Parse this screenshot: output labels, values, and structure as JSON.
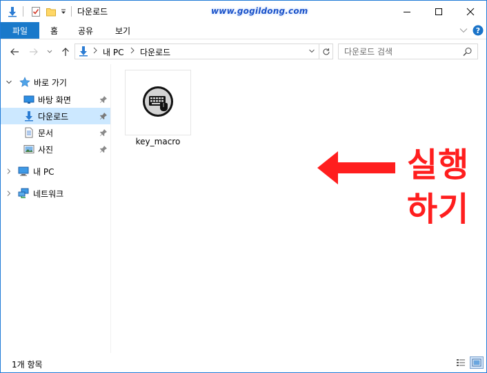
{
  "window": {
    "title": "다운로드",
    "watermark": "www.gogildong.com"
  },
  "ribbon": {
    "tabs": [
      "파일",
      "홈",
      "공유",
      "보기"
    ],
    "active_tab": "파일"
  },
  "address": {
    "path": [
      "내 PC",
      "다운로드"
    ],
    "search_placeholder": "다운로드 검색"
  },
  "nav": {
    "quick_access": {
      "label": "바로 가기",
      "expanded": true,
      "items": [
        {
          "label": "바탕 화면",
          "icon": "desktop-icon",
          "pinned": true,
          "selected": false
        },
        {
          "label": "다운로드",
          "icon": "download-arrow-icon",
          "pinned": true,
          "selected": true
        },
        {
          "label": "문서",
          "icon": "document-icon",
          "pinned": true,
          "selected": false
        },
        {
          "label": "사진",
          "icon": "pictures-icon",
          "pinned": true,
          "selected": false
        }
      ]
    },
    "this_pc": {
      "label": "내 PC",
      "expanded": false
    },
    "network": {
      "label": "네트워크",
      "expanded": false
    }
  },
  "content": {
    "files": [
      {
        "name": "key_macro",
        "icon": "keyboard-macro-icon"
      }
    ],
    "annotation": "실행하기"
  },
  "status": {
    "item_count": "1개 항목"
  },
  "colors": {
    "accent": "#1979ca",
    "selection": "#cce8ff",
    "annotation": "#ff1e1e",
    "watermark": "#1a52c9"
  }
}
